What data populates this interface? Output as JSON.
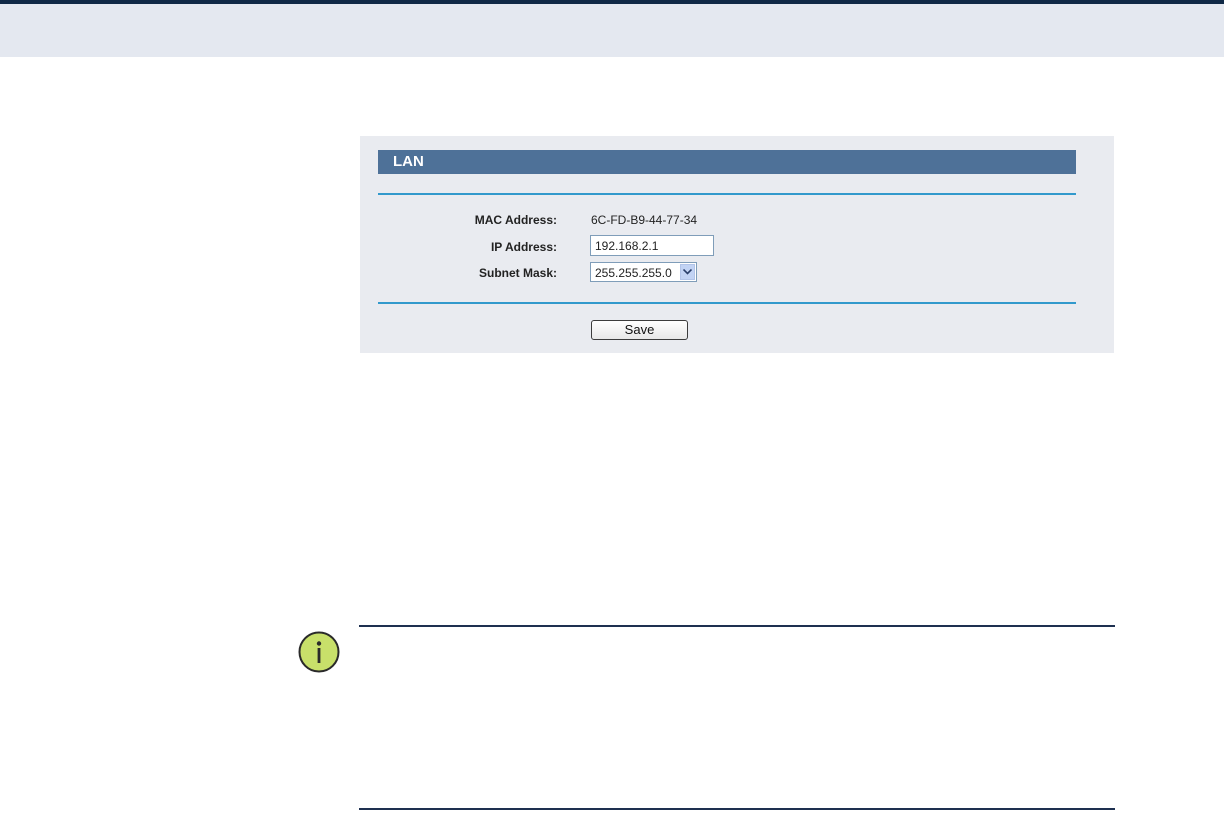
{
  "panel": {
    "title": "LAN",
    "fields": {
      "mac_label": "MAC Address:",
      "mac_value": "6C-FD-B9-44-77-34",
      "ip_label": "IP Address:",
      "ip_value": "192.168.2.1",
      "subnet_label": "Subnet Mask:",
      "subnet_value": "255.255.255.0"
    },
    "save_label": "Save"
  },
  "note": {
    "icon": "info-icon"
  },
  "colors": {
    "title_bar": "#4e7198",
    "divider": "#3299cc",
    "panel_bg": "#e9ebf0",
    "header_band": "#e4e8f0",
    "icon_fill": "#c8e06a"
  }
}
